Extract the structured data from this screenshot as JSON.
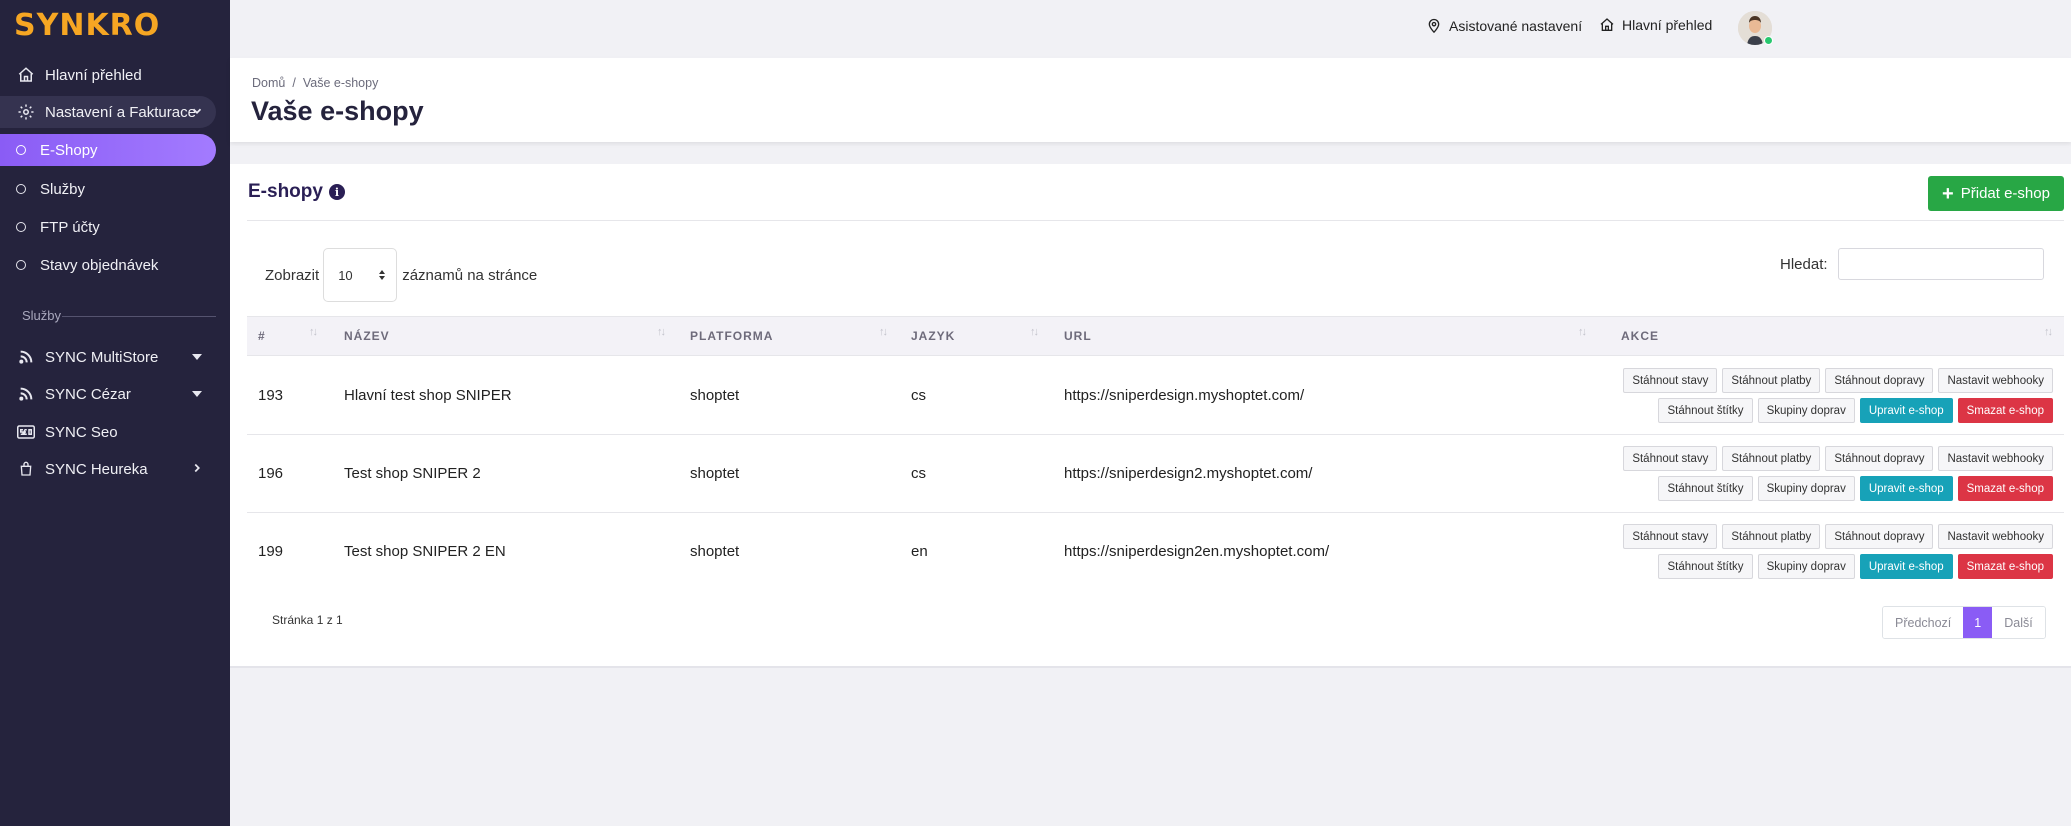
{
  "app": {
    "logo": "SYNKRO"
  },
  "sidebar": {
    "items": [
      {
        "label": "Hlavní přehled",
        "icon": "home-icon"
      },
      {
        "label": "Nastavení a Fakturace",
        "icon": "gear-icon"
      }
    ],
    "sub_items": [
      {
        "label": "E-Shopy",
        "active": true
      },
      {
        "label": "Služby"
      },
      {
        "label": "FTP účty"
      },
      {
        "label": "Stavy objednávek"
      }
    ],
    "section_label": "Služby",
    "services": [
      {
        "label": "SYNC MultiStore",
        "icon": "rss-icon"
      },
      {
        "label": "SYNC Cézar",
        "icon": "rss-icon"
      },
      {
        "label": "SYNC Seo",
        "icon": "seo-icon"
      },
      {
        "label": "SYNC Heureka",
        "icon": "bag-icon"
      }
    ]
  },
  "topbar": {
    "assisted_setup": "Asistované nastavení",
    "dashboard": "Hlavní přehled"
  },
  "header": {
    "breadcrumb": [
      "Domů",
      "Vaše e-shopy"
    ],
    "breadcrumb_sep": "/",
    "title": "Vaše e-shopy"
  },
  "card": {
    "title": "E-shopy",
    "info_glyph": "i",
    "add_button": "Přidat e-shop",
    "add_glyph": "+",
    "length_prefix": "Zobrazit",
    "length_value": "10",
    "length_suffix": "záznamů na stránce",
    "search_label": "Hledat:",
    "search_value": ""
  },
  "table": {
    "columns": [
      "#",
      "NÁZEV",
      "PLATFORMA",
      "JAZYK",
      "URL",
      "AKCE"
    ],
    "rows": [
      {
        "id": "193",
        "name": "Hlavní test shop SNIPER",
        "platform": "shoptet",
        "lang": "cs",
        "url": "https://sniperdesign.myshoptet.com/"
      },
      {
        "id": "196",
        "name": "Test shop SNIPER 2",
        "platform": "shoptet",
        "lang": "cs",
        "url": "https://sniperdesign2.myshoptet.com/"
      },
      {
        "id": "199",
        "name": "Test shop SNIPER 2 EN",
        "platform": "shoptet",
        "lang": "en",
        "url": "https://sniperdesign2en.myshoptet.com/"
      }
    ],
    "actions": {
      "states": "Stáhnout stavy",
      "payments": "Stáhnout platby",
      "shipping": "Stáhnout dopravy",
      "webhooks": "Nastavit webhooky",
      "labels": "Stáhnout štítky",
      "groups": "Skupiny doprav",
      "edit": "Upravit e-shop",
      "delete": "Smazat e-shop"
    }
  },
  "pagination": {
    "info": "Stránka 1 z 1",
    "prev": "Předchozí",
    "current": "1",
    "next": "Další"
  },
  "colors": {
    "sidebar_bg": "#25233d",
    "accent": "#8a5cf5",
    "logo": "#f6a623",
    "success": "#28a745",
    "info": "#17a2b8",
    "danger": "#dc3545"
  }
}
